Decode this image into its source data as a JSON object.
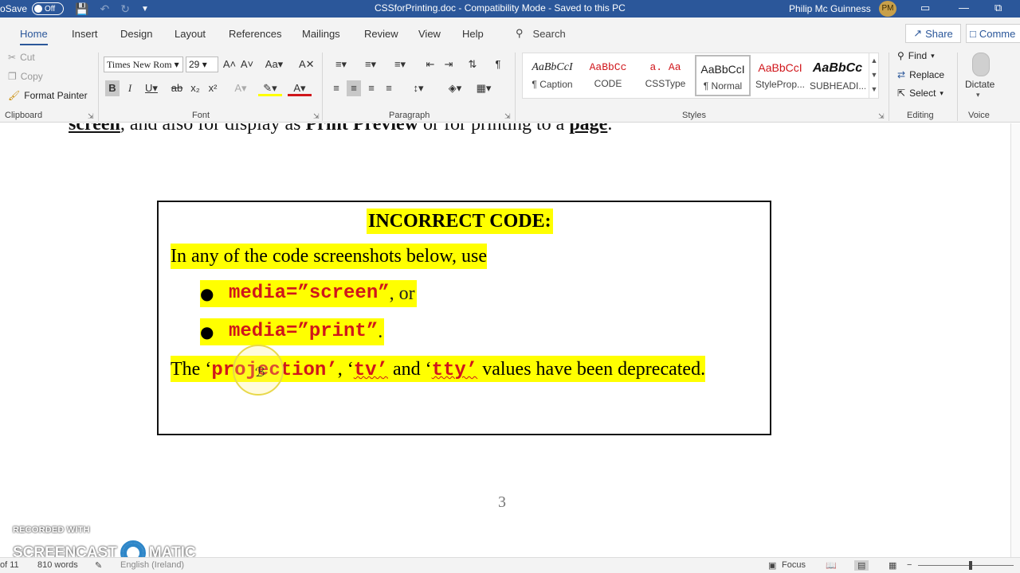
{
  "titlebar": {
    "autosave_label": "oSave",
    "autosave_state": "Off",
    "document_title": "CSSforPrinting.doc  -  Compatibility Mode  -  Saved to this PC",
    "user_name": "Philip Mc Guinness",
    "user_initials": "PM"
  },
  "tabs": [
    "Home",
    "Insert",
    "Design",
    "Layout",
    "References",
    "Mailings",
    "Review",
    "View",
    "Help"
  ],
  "search_label": "Search",
  "share_label": "Share",
  "comments_label": "Comme",
  "clipboard": {
    "cut": "Cut",
    "copy": "Copy",
    "format_painter": "Format Painter",
    "group_label": "Clipboard"
  },
  "font": {
    "name": "Times New Rom",
    "size": "29",
    "group_label": "Font"
  },
  "paragraph": {
    "group_label": "Paragraph"
  },
  "styles": {
    "group_label": "Styles",
    "items": [
      {
        "sample": "AaBbCcI",
        "name": "¶ Caption"
      },
      {
        "sample": "AaBbCc",
        "name": "CODE"
      },
      {
        "sample": "a.  Aa",
        "name": "CSSType"
      },
      {
        "sample": "AaBbCcI",
        "name": "¶ Normal"
      },
      {
        "sample": "AaBbCcI",
        "name": "StyleProp..."
      },
      {
        "sample": "AaBbCc",
        "name": "SUBHEADI..."
      }
    ]
  },
  "editing": {
    "find": "Find",
    "replace": "Replace",
    "select": "Select",
    "group_label": "Editing"
  },
  "voice": {
    "dictate": "Dictate",
    "group_label": "Voice"
  },
  "document": {
    "prev_text_1": "screen",
    "prev_text_2": ", and also for display as ",
    "prev_text_3": "Print Preview",
    "prev_text_4": " or for printing to a ",
    "prev_text_5": "page",
    "prev_text_6": ".",
    "box_title": "INCORRECT CODE:",
    "intro": "In any of the code screenshots below, use",
    "bullet1_code": "media=”screen”",
    "bullet1_tail": ", or",
    "bullet2_code": "media=”print”",
    "bullet2_tail": ".",
    "last_1": "The ‘",
    "last_code1": "projection’",
    "last_2": ", ‘",
    "last_code2": "tv’",
    "last_3": " and ‘",
    "last_code3": "tty’",
    "last_4": " values have been deprecated.",
    "page_number": "3"
  },
  "watermark": {
    "line1": "RECORDED WITH",
    "line2a": "SCREENCAST",
    "line2b": "MATIC"
  },
  "statusbar": {
    "page": "of 11",
    "words": "810 words",
    "language": "English (Ireland)",
    "focus": "Focus"
  },
  "colors": {
    "accent": "#2b579a",
    "highlight": "#ffff00",
    "code_red": "#d0161b"
  }
}
